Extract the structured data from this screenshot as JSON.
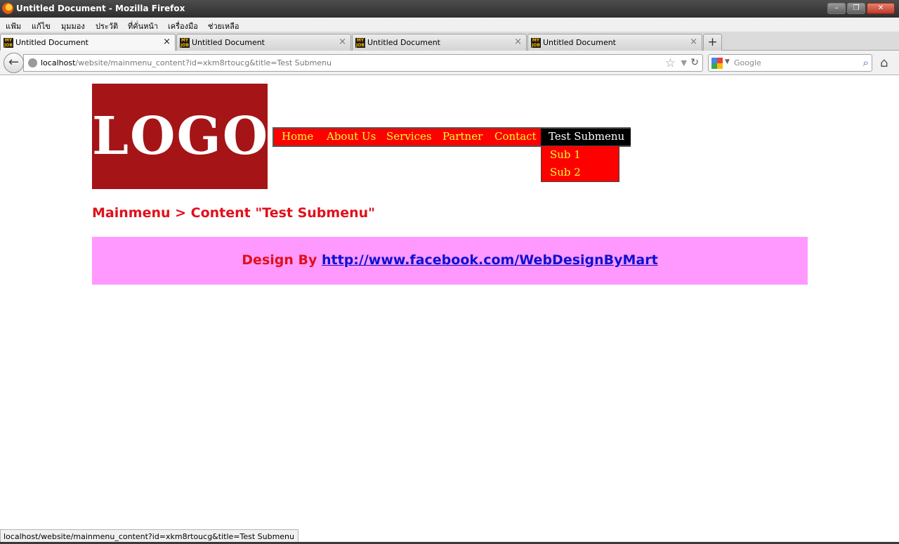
{
  "window": {
    "title": "Untitled Document - Mozilla Firefox",
    "minimize_label": "–",
    "restore_label": "❐",
    "close_label": "✕"
  },
  "menubar": {
    "items": [
      "แฟ้ม",
      "แก้ไข",
      "มุมมอง",
      "ประวัติ",
      "ที่คั่นหน้า",
      "เครื่องมือ",
      "ช่วยเหลือ"
    ]
  },
  "tabs": [
    {
      "label": "Untitled Document",
      "active": true
    },
    {
      "label": "Untitled Document",
      "active": false
    },
    {
      "label": "Untitled Document",
      "active": false
    },
    {
      "label": "Untitled Document",
      "active": false
    }
  ],
  "tab_favicon_text": "MY JOB",
  "tab_close_glyph": "×",
  "new_tab_glyph": "+",
  "navbar": {
    "back_glyph": "←",
    "url_host": "localhost",
    "url_rest": "/website/mainmenu_content?id=xkm8rtoucg&title=Test Submenu",
    "search_placeholder": "Google",
    "icons": [
      "back-icon",
      "globe-icon",
      "star-icon",
      "dropdown-icon",
      "reload-icon",
      "google-icon",
      "magnifier-icon",
      "home-icon"
    ]
  },
  "page": {
    "logo_text": "LOGO",
    "nav": {
      "items": [
        "Home",
        "About Us",
        "Services",
        "Partner",
        "Contact",
        "Test Submenu"
      ],
      "active_index": 5
    },
    "submenu": [
      "Sub 1",
      "Sub 2"
    ],
    "breadcrumb": "Mainmenu > Content \"Test Submenu\"",
    "footer": {
      "label": "Design By",
      "link": "http://www.facebook.com/WebDesignByMart"
    }
  },
  "status_text": "localhost/website/mainmenu_content?id=xkm8rtoucg&title=Test Submenu",
  "colors": {
    "logo_bg": "#a51417",
    "nav_bg": "#ff0000",
    "nav_text": "#ffff33",
    "nav_active_bg": "#000000",
    "heading": "#e0101b",
    "footer_bg": "#ff99ff",
    "link": "#1010d0"
  }
}
